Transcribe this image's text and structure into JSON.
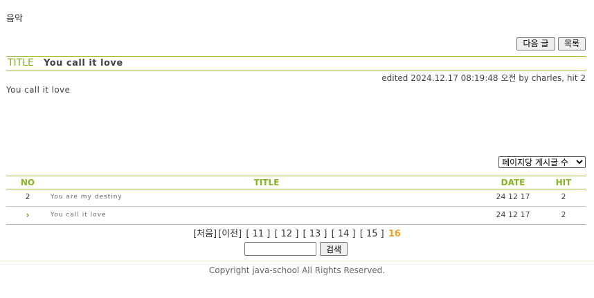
{
  "category": "음악",
  "buttons": {
    "next": "다음 글",
    "list": "목록"
  },
  "article": {
    "title_label": "TITLE",
    "title": "You call it love",
    "meta": "edited 2024.12.17 08:19:48 오전 by charles, hit 2",
    "content": "You call it love"
  },
  "per_page": {
    "selected": "페이지당 게시글 수"
  },
  "list": {
    "headers": {
      "no": "NO",
      "title": "TITLE",
      "date": "DATE",
      "hit": "HIT"
    },
    "rows": [
      {
        "no": "2",
        "title": "You are my destiny",
        "date": "24 12 17",
        "hit": "2"
      },
      {
        "no": "",
        "title": "You call it love",
        "date": "24 12 17",
        "hit": "2",
        "current": true
      }
    ],
    "current_marker": "›"
  },
  "pagination": {
    "first": "[처음]",
    "prev": "[이전]",
    "pages": [
      "[ 11 ]",
      "[ 12 ]",
      "[ 13 ]",
      "[ 14 ]",
      "[ 15 ]"
    ],
    "current": "16"
  },
  "search": {
    "value": "",
    "button": "검색"
  },
  "footer": "Copyright java-school All Rights Reserved.",
  "colors": {
    "accent": "#88b322",
    "current_page": "#f0a020",
    "rule": "#99bb33"
  }
}
